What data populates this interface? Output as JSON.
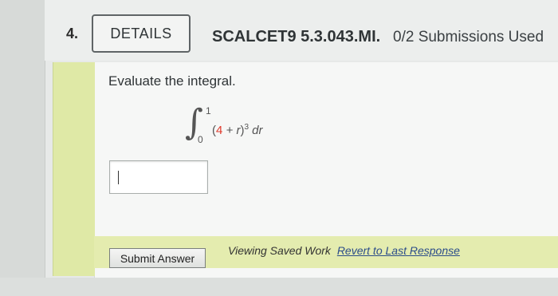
{
  "question": {
    "number": "4.",
    "details_label": "DETAILS",
    "code": "SCALCET9 5.3.043.MI.",
    "submissions": "0/2 Submissions Used"
  },
  "problem": {
    "prompt": "Evaluate the integral.",
    "integral": {
      "upper_limit": "1",
      "lower_limit": "0",
      "paren_open": "(",
      "constant": "4",
      "plus_r": " + r",
      "paren_close": ")",
      "exponent": "3",
      "differential": " dr"
    }
  },
  "answer": {
    "value": ""
  },
  "footer": {
    "submit_label": "Submit Answer",
    "status_text": "Viewing Saved Work",
    "revert_label": "Revert to Last Response"
  },
  "colors": {
    "highlight_green": "#e4ecaf",
    "constant_red": "#e0392b",
    "link_blue": "#2c4d8a"
  }
}
